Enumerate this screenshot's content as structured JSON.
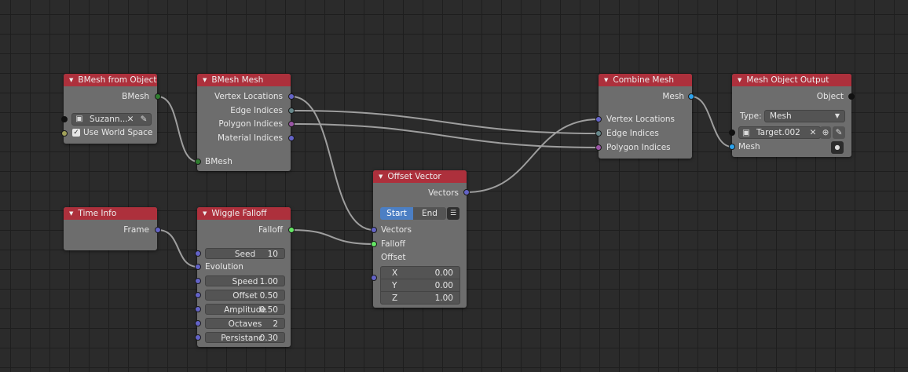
{
  "nodes": {
    "bmesh_from_object": {
      "title": "BMesh from Object",
      "out_bmesh": "BMesh",
      "object_value": "Suzann...",
      "use_world_space": "Use World Space"
    },
    "bmesh_mesh": {
      "title": "BMesh Mesh",
      "vertex_locations": "Vertex Locations",
      "edge_indices": "Edge Indices",
      "polygon_indices": "Polygon Indices",
      "material_indices": "Material Indices",
      "in_bmesh": "BMesh"
    },
    "time_info": {
      "title": "Time Info",
      "frame": "Frame"
    },
    "wiggle_falloff": {
      "title": "Wiggle Falloff",
      "falloff": "Falloff",
      "seed_label": "Seed",
      "seed_value": "10",
      "evolution": "Evolution",
      "speed_label": "Speed",
      "speed_value": "1.00",
      "offset_label": "Offset",
      "offset_value": "0.50",
      "amplitude_label": "Amplitude",
      "amplitude_value": "0.50",
      "octaves_label": "Octaves",
      "octaves_value": "2",
      "persistance_label": "Persistanc",
      "persistance_value": "0.30"
    },
    "offset_vector": {
      "title": "Offset Vector",
      "vectors_out": "Vectors",
      "start": "Start",
      "end": "End",
      "vectors_in": "Vectors",
      "falloff": "Falloff",
      "offset": "Offset",
      "x_label": "X",
      "x_value": "0.00",
      "y_label": "Y",
      "y_value": "0.00",
      "z_label": "Z",
      "z_value": "1.00"
    },
    "combine_mesh": {
      "title": "Combine Mesh",
      "mesh_out": "Mesh",
      "vertex_locations": "Vertex Locations",
      "edge_indices": "Edge Indices",
      "polygon_indices": "Polygon Indices"
    },
    "mesh_object_output": {
      "title": "Mesh Object Output",
      "object_out": "Object",
      "type_label": "Type:",
      "type_value": "Mesh",
      "target_value": "Target.002",
      "mesh_in": "Mesh"
    }
  },
  "colors": {
    "header": "#ad303c",
    "node_body": "#6d6d6d",
    "background": "#2b2b2b",
    "wire": "#b3b3b3",
    "active_toggle": "#4c7fc4"
  }
}
